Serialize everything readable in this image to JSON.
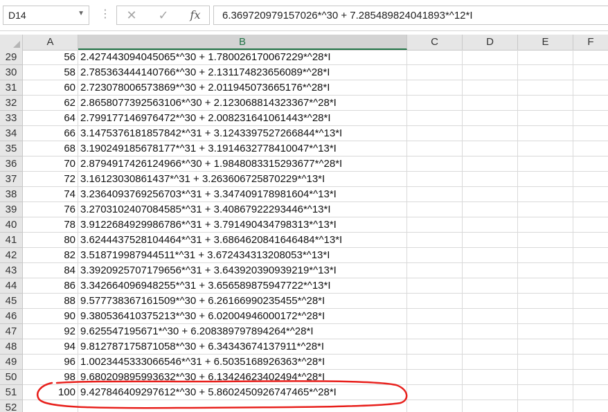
{
  "name_box": {
    "value": "D14"
  },
  "formula_bar": {
    "dots": "⋮",
    "cancel_icon": "✕",
    "enter_icon": "✓",
    "fx_label": "fx",
    "formula": "6.369720979157026*^30 + 7.285489824041893*^12*I"
  },
  "columns": [
    "A",
    "B",
    "C",
    "D",
    "E",
    "F"
  ],
  "rows": [
    {
      "num": "29",
      "a": "56",
      "b": "2.427443094045065*^30 + 1.780026170067229*^28*I"
    },
    {
      "num": "30",
      "a": "58",
      "b": "2.785363444140766*^30 + 2.131174823656089*^28*I"
    },
    {
      "num": "31",
      "a": "60",
      "b": "2.723078006573869*^30 + 2.011945073665176*^28*I"
    },
    {
      "num": "32",
      "a": "62",
      "b": "2.8658077392563106*^30 + 2.123068814323367*^28*I"
    },
    {
      "num": "33",
      "a": "64",
      "b": "2.799177146976472*^30 + 2.008231641061443*^28*I"
    },
    {
      "num": "34",
      "a": "66",
      "b": "3.1475376181857842*^31 + 3.1243397527266844*^13*I"
    },
    {
      "num": "35",
      "a": "68",
      "b": "3.190249185678177*^31 + 3.1914632778410047*^13*I"
    },
    {
      "num": "36",
      "a": "70",
      "b": "2.8794917426124966*^30 + 1.9848083315293677*^28*I"
    },
    {
      "num": "37",
      "a": "72",
      "b": "3.16123030861437*^31 + 3.263606725870229*^13*I"
    },
    {
      "num": "38",
      "a": "74",
      "b": "3.2364093769256703*^31 + 3.347409178981604*^13*I"
    },
    {
      "num": "39",
      "a": "76",
      "b": "3.2703102407084585*^31 + 3.40867922293446*^13*I"
    },
    {
      "num": "40",
      "a": "78",
      "b": "3.9122684929986786*^31 + 3.791490434798313*^13*I"
    },
    {
      "num": "41",
      "a": "80",
      "b": "3.6244437528104464*^31 + 3.6864620841646484*^13*I"
    },
    {
      "num": "42",
      "a": "82",
      "b": "3.518719987944511*^31 + 3.672434313208053*^13*I"
    },
    {
      "num": "43",
      "a": "84",
      "b": "3.3920925707179656*^31 + 3.643920390939219*^13*I"
    },
    {
      "num": "44",
      "a": "86",
      "b": "3.342664096948255*^31 + 3.656589875947722*^13*I"
    },
    {
      "num": "45",
      "a": "88",
      "b": "9.577738367161509*^30 + 6.26166990235455*^28*I"
    },
    {
      "num": "46",
      "a": "90",
      "b": "9.380536410375213*^30 + 6.02004946000172*^28*I"
    },
    {
      "num": "47",
      "a": "92",
      "b": "9.625547195671*^30 + 6.208389797894264*^28*I"
    },
    {
      "num": "48",
      "a": "94",
      "b": "9.812787175871058*^30 + 6.34343674137911*^28*I"
    },
    {
      "num": "49",
      "a": "96",
      "b": "1.0023445333066546*^31 + 6.5035168926363*^28*I"
    },
    {
      "num": "50",
      "a": "98",
      "b": "9.680209895993632*^30 + 6.13424623402494*^28*I"
    },
    {
      "num": "51",
      "a": "100",
      "b": "9.427846409297612*^30 + 5.8602450926747465*^28*I"
    },
    {
      "num": "52",
      "a": "",
      "b": ""
    }
  ],
  "colors": {
    "header_bg": "#e6e6e6",
    "active_col": "#217346",
    "annotation": "#e8201c"
  }
}
